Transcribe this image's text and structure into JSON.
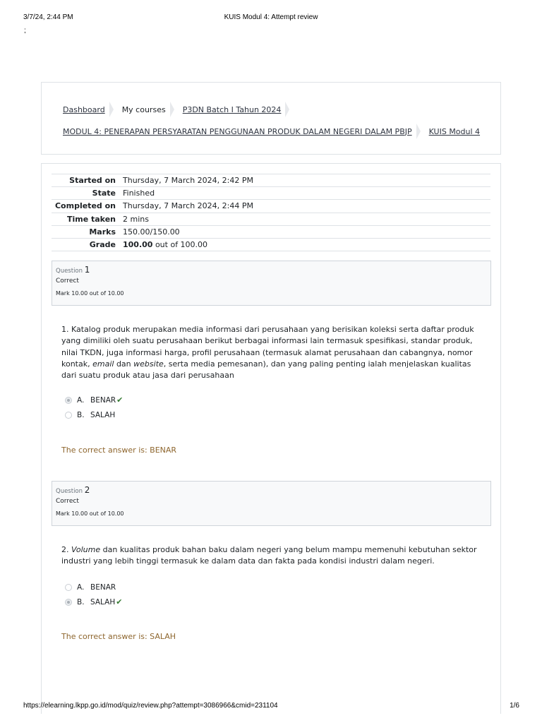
{
  "print_header": {
    "date": "3/7/24, 2:44 PM",
    "title": "KUIS Modul 4: Attempt review",
    "mark": ";"
  },
  "breadcrumb": {
    "row1": [
      {
        "label": "Dashboard",
        "link": true
      },
      {
        "label": "My courses",
        "link": false
      },
      {
        "label": "P3DN Batch I Tahun 2024",
        "link": true
      }
    ],
    "row2": [
      {
        "label": "MODUL 4: PENERAPAN PERSYARATAN PENGGUNAAN PRODUK DALAM NEGERI DALAM PBJP",
        "link": true
      },
      {
        "label": "KUIS Modul 4",
        "link": true
      }
    ]
  },
  "summary": {
    "started_on": {
      "label": "Started on",
      "value": "Thursday, 7 March 2024, 2:42 PM"
    },
    "state": {
      "label": "State",
      "value": "Finished"
    },
    "completed_on": {
      "label": "Completed on",
      "value": "Thursday, 7 March 2024, 2:44 PM"
    },
    "time_taken": {
      "label": "Time taken",
      "value": "2 mins"
    },
    "marks": {
      "label": "Marks",
      "value": "150.00/150.00"
    },
    "grade": {
      "label": "Grade",
      "value_bold": "100.00",
      "value_rest": " out of 100.00"
    }
  },
  "questions": [
    {
      "label": "Question ",
      "number": "1",
      "state": "Correct",
      "mark": "Mark 10.00 out of 10.00",
      "text_parts": [
        {
          "t": "1. Katalog produk merupakan media informasi dari perusahaan yang berisikan koleksi serta daftar produk yang dimiliki oleh suatu perusahaan berikut berbagai informasi lain termasuk spesifikasi, standar produk, nilai TKDN, juga informasi harga, profil perusahaan (termasuk alamat perusahaan dan cabangnya, nomor kontak, ",
          "i": false
        },
        {
          "t": "email",
          "i": true
        },
        {
          "t": " dan ",
          "i": false
        },
        {
          "t": "website",
          "i": true
        },
        {
          "t": ", serta media pemesanan), dan yang paling penting ialah menjelaskan kualitas dari suatu produk atau jasa dari perusahaan",
          "i": false
        }
      ],
      "answers": [
        {
          "letter": "A.",
          "text": "BENAR",
          "checked": true,
          "correct": true
        },
        {
          "letter": "B.",
          "text": "SALAH",
          "checked": false,
          "correct": false
        }
      ],
      "correct_answer": "The correct answer is: BENAR"
    },
    {
      "label": "Question ",
      "number": "2",
      "state": "Correct",
      "mark": "Mark 10.00 out of 10.00",
      "text_parts": [
        {
          "t": "2. ",
          "i": false
        },
        {
          "t": "Volume",
          "i": true
        },
        {
          "t": " dan kualitas produk bahan baku dalam negeri yang belum mampu memenuhi kebutuhan sektor industri yang lebih tinggi termasuk ke dalam data dan fakta pada kondisi industri dalam negeri.",
          "i": false
        }
      ],
      "answers": [
        {
          "letter": "A.",
          "text": "BENAR",
          "checked": false,
          "correct": false
        },
        {
          "letter": "B.",
          "text": "SALAH",
          "checked": true,
          "correct": true
        }
      ],
      "correct_answer": "The correct answer is: SALAH"
    }
  ],
  "check_glyph": "✔",
  "print_footer": {
    "url": "https://elearning.lkpp.go.id/mod/quiz/review.php?attempt=3086966&cmid=231104",
    "page": "1/6"
  },
  "colors": {
    "correct_check": "#357a32",
    "correct_answer_text": "#8e662e"
  }
}
